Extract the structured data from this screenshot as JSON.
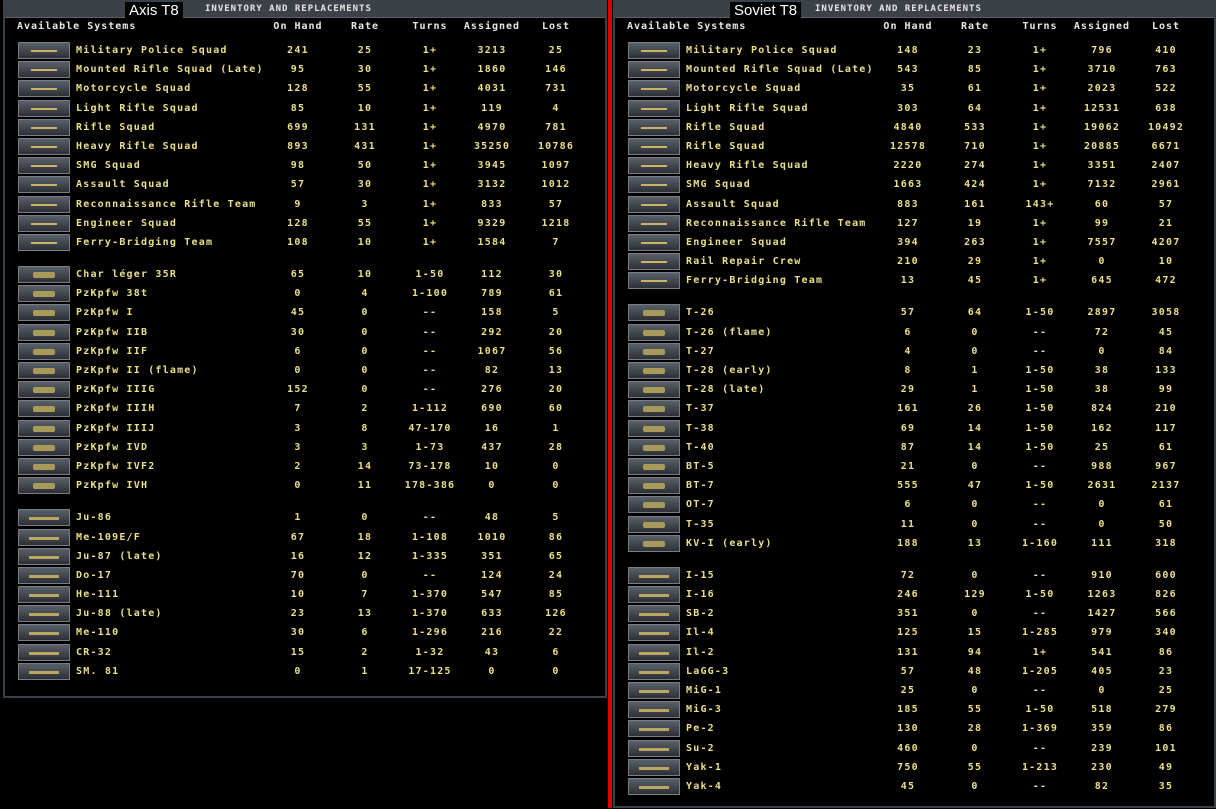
{
  "title": "INVENTORY AND REPLACEMENTS",
  "columns": {
    "name": "Available Systems",
    "on_hand": "On Hand",
    "rate": "Rate",
    "turns": "Turns",
    "assigned": "Assigned",
    "lost": "Lost"
  },
  "text_color": "#ecdf8a",
  "divider_color": "#e00000",
  "panels": [
    {
      "id": "axis",
      "side": "Axis T8",
      "groups": [
        {
          "type": "infantry",
          "rows": [
            [
              "Military Police Squad",
              "241",
              "25",
              "1+",
              "3213",
              "25"
            ],
            [
              "Mounted Rifle Squad (Late)",
              "95",
              "30",
              "1+",
              "1860",
              "146"
            ],
            [
              "Motorcycle Squad",
              "128",
              "55",
              "1+",
              "4031",
              "731"
            ],
            [
              "Light Rifle Squad",
              "85",
              "10",
              "1+",
              "119",
              "4"
            ],
            [
              "Rifle Squad",
              "699",
              "131",
              "1+",
              "4970",
              "781"
            ],
            [
              "Heavy Rifle Squad",
              "893",
              "431",
              "1+",
              "35250",
              "10786"
            ],
            [
              "SMG Squad",
              "98",
              "50",
              "1+",
              "3945",
              "1097"
            ],
            [
              "Assault Squad",
              "57",
              "30",
              "1+",
              "3132",
              "1012"
            ],
            [
              "Reconnaissance Rifle Team",
              "9",
              "3",
              "1+",
              "833",
              "57"
            ],
            [
              "Engineer Squad",
              "128",
              "55",
              "1+",
              "9329",
              "1218"
            ],
            [
              "Ferry-Bridging Team",
              "108",
              "10",
              "1+",
              "1584",
              "7"
            ]
          ]
        },
        {
          "type": "armor",
          "rows": [
            [
              "Char léger 35R",
              "65",
              "10",
              "1-50",
              "112",
              "30"
            ],
            [
              "PzKpfw 38t",
              "0",
              "4",
              "1-100",
              "789",
              "61"
            ],
            [
              "PzKpfw I",
              "45",
              "0",
              "--",
              "158",
              "5"
            ],
            [
              "PzKpfw IIB",
              "30",
              "0",
              "--",
              "292",
              "20"
            ],
            [
              "PzKpfw IIF",
              "6",
              "0",
              "--",
              "1067",
              "56"
            ],
            [
              "PzKpfw II (flame)",
              "0",
              "0",
              "--",
              "82",
              "13"
            ],
            [
              "PzKpfw IIIG",
              "152",
              "0",
              "--",
              "276",
              "20"
            ],
            [
              "PzKpfw IIIH",
              "7",
              "2",
              "1-112",
              "690",
              "60"
            ],
            [
              "PzKpfw IIIJ",
              "3",
              "8",
              "47-170",
              "16",
              "1"
            ],
            [
              "PzKpfw IVD",
              "3",
              "3",
              "1-73",
              "437",
              "28"
            ],
            [
              "PzKpfw IVF2",
              "2",
              "14",
              "73-178",
              "10",
              "0"
            ],
            [
              "PzKpfw IVH",
              "0",
              "11",
              "178-386",
              "0",
              "0"
            ]
          ]
        },
        {
          "type": "air",
          "rows": [
            [
              "Ju-86",
              "1",
              "0",
              "--",
              "48",
              "5"
            ],
            [
              "Me-109E/F",
              "67",
              "18",
              "1-108",
              "1010",
              "86"
            ],
            [
              "Ju-87 (late)",
              "16",
              "12",
              "1-335",
              "351",
              "65"
            ],
            [
              "Do-17",
              "70",
              "0",
              "--",
              "124",
              "24"
            ],
            [
              "He-111",
              "10",
              "7",
              "1-370",
              "547",
              "85"
            ],
            [
              "Ju-88 (late)",
              "23",
              "13",
              "1-370",
              "633",
              "126"
            ],
            [
              "Me-110",
              "30",
              "6",
              "1-296",
              "216",
              "22"
            ],
            [
              "CR-32",
              "15",
              "2",
              "1-32",
              "43",
              "6"
            ],
            [
              "SM. 81",
              "0",
              "1",
              "17-125",
              "0",
              "0"
            ]
          ]
        }
      ]
    },
    {
      "id": "soviet",
      "side": "Soviet T8",
      "groups": [
        {
          "type": "infantry",
          "rows": [
            [
              "Military Police Squad",
              "148",
              "23",
              "1+",
              "796",
              "410"
            ],
            [
              "Mounted Rifle Squad (Late)",
              "543",
              "85",
              "1+",
              "3710",
              "763"
            ],
            [
              "Motorcycle Squad",
              "35",
              "61",
              "1+",
              "2023",
              "522"
            ],
            [
              "Light Rifle Squad",
              "303",
              "64",
              "1+",
              "12531",
              "638"
            ],
            [
              "Rifle Squad",
              "4840",
              "533",
              "1+",
              "19062",
              "10492"
            ],
            [
              "Rifle Squad",
              "12578",
              "710",
              "1+",
              "20885",
              "6671"
            ],
            [
              "Heavy Rifle Squad",
              "2220",
              "274",
              "1+",
              "3351",
              "2407"
            ],
            [
              "SMG Squad",
              "1663",
              "424",
              "1+",
              "7132",
              "2961"
            ],
            [
              "Assault Squad",
              "883",
              "161",
              "143+",
              "60",
              "57"
            ],
            [
              "Reconnaissance Rifle Team",
              "127",
              "19",
              "1+",
              "99",
              "21"
            ],
            [
              "Engineer Squad",
              "394",
              "263",
              "1+",
              "7557",
              "4207"
            ],
            [
              "Rail Repair Crew",
              "210",
              "29",
              "1+",
              "0",
              "10"
            ],
            [
              "Ferry-Bridging Team",
              "13",
              "45",
              "1+",
              "645",
              "472"
            ]
          ]
        },
        {
          "type": "armor",
          "rows": [
            [
              "T-26",
              "57",
              "64",
              "1-50",
              "2897",
              "3058"
            ],
            [
              "T-26 (flame)",
              "6",
              "0",
              "--",
              "72",
              "45"
            ],
            [
              "T-27",
              "4",
              "0",
              "--",
              "0",
              "84"
            ],
            [
              "T-28 (early)",
              "8",
              "1",
              "1-50",
              "38",
              "133"
            ],
            [
              "T-28 (late)",
              "29",
              "1",
              "1-50",
              "38",
              "99"
            ],
            [
              "T-37",
              "161",
              "26",
              "1-50",
              "824",
              "210"
            ],
            [
              "T-38",
              "69",
              "14",
              "1-50",
              "162",
              "117"
            ],
            [
              "T-40",
              "87",
              "14",
              "1-50",
              "25",
              "61"
            ],
            [
              "BT-5",
              "21",
              "0",
              "--",
              "988",
              "967"
            ],
            [
              "BT-7",
              "555",
              "47",
              "1-50",
              "2631",
              "2137"
            ],
            [
              "OT-7",
              "6",
              "0",
              "--",
              "0",
              "61"
            ],
            [
              "T-35",
              "11",
              "0",
              "--",
              "0",
              "50"
            ],
            [
              "KV-I (early)",
              "188",
              "13",
              "1-160",
              "111",
              "318"
            ]
          ]
        },
        {
          "type": "air",
          "rows": [
            [
              "I-15",
              "72",
              "0",
              "--",
              "910",
              "600"
            ],
            [
              "I-16",
              "246",
              "129",
              "1-50",
              "1263",
              "826"
            ],
            [
              "SB-2",
              "351",
              "0",
              "--",
              "1427",
              "566"
            ],
            [
              "Il-4",
              "125",
              "15",
              "1-285",
              "979",
              "340"
            ],
            [
              "Il-2",
              "131",
              "94",
              "1+",
              "541",
              "86"
            ],
            [
              "LaGG-3",
              "57",
              "48",
              "1-205",
              "405",
              "23"
            ],
            [
              "MiG-1",
              "25",
              "0",
              "--",
              "0",
              "25"
            ],
            [
              "MiG-3",
              "185",
              "55",
              "1-50",
              "518",
              "279"
            ],
            [
              "Pe-2",
              "130",
              "28",
              "1-369",
              "359",
              "86"
            ],
            [
              "Su-2",
              "460",
              "0",
              "--",
              "239",
              "101"
            ],
            [
              "Yak-1",
              "750",
              "55",
              "1-213",
              "230",
              "49"
            ],
            [
              "Yak-4",
              "45",
              "0",
              "--",
              "82",
              "35"
            ]
          ]
        }
      ]
    }
  ]
}
